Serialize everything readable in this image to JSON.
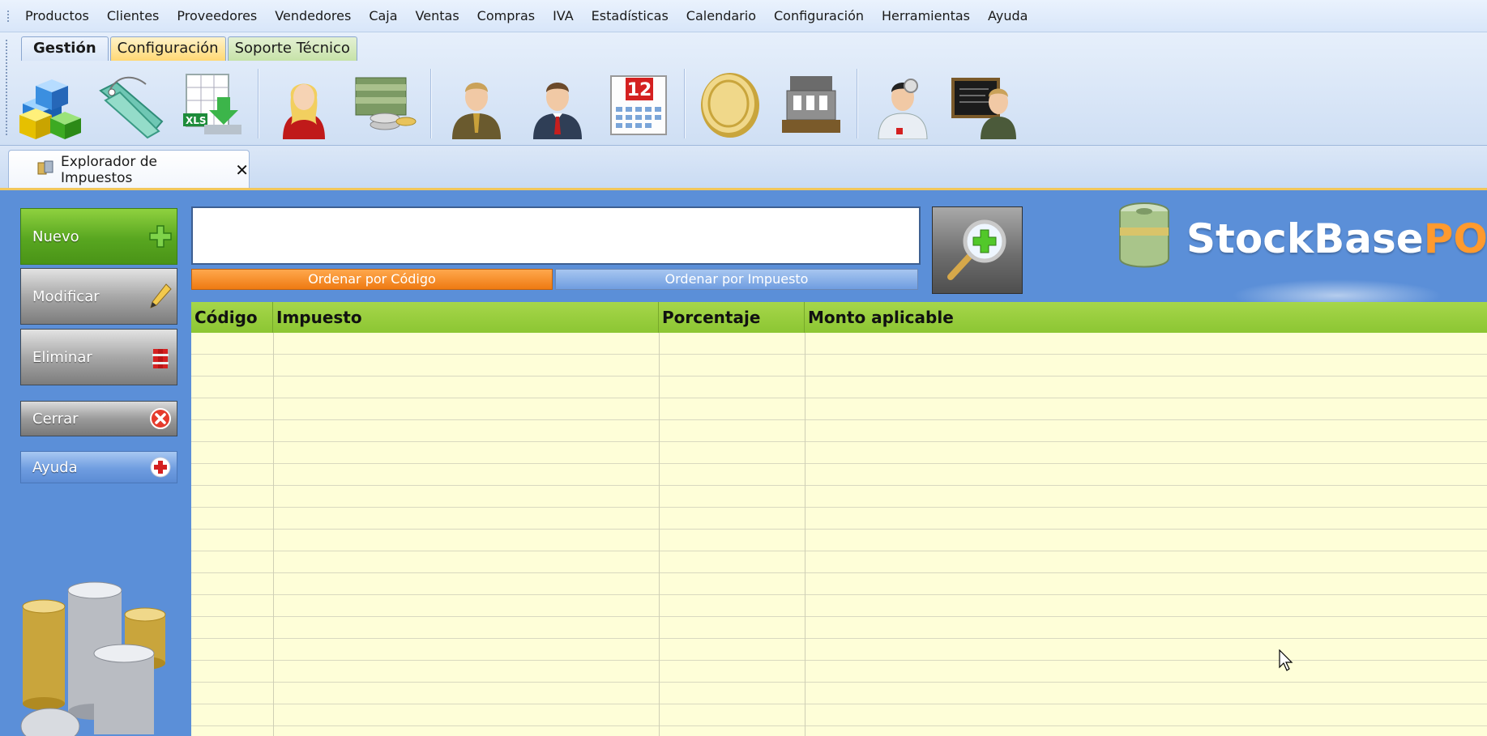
{
  "menu": [
    "Productos",
    "Clientes",
    "Proveedores",
    "Vendedores",
    "Caja",
    "Ventas",
    "Compras",
    "IVA",
    "Estadísticas",
    "Calendario",
    "Configuración",
    "Herramientas",
    "Ayuda"
  ],
  "ribbon": {
    "tabs": [
      "Gestión",
      "Configuración",
      "Soporte Técnico"
    ],
    "icons": [
      "products-cubes-icon",
      "price-tags-icon",
      "xls-import-icon",
      "customer-woman-icon",
      "cash-money-icon",
      "vendor-man-icon",
      "seller-man-icon",
      "calendar-icon",
      "coin-icon",
      "cash-register-icon",
      "doctor-support-icon",
      "teacher-board-icon"
    ],
    "calendar_day": "12",
    "xls_label": "XLS"
  },
  "document_tab": {
    "title": "Explorador de Impuestos",
    "close": "✕"
  },
  "sidebar": {
    "nuevo": "Nuevo",
    "modificar": "Modificar",
    "eliminar": "Eliminar",
    "cerrar": "Cerrar",
    "ayuda": "Ayuda"
  },
  "search": {
    "value": "",
    "placeholder": ""
  },
  "sort": {
    "by_code": "Ordenar por Código",
    "by_tax": "Ordenar por Impuesto",
    "active": "by_code"
  },
  "brand": {
    "name": "StockBase",
    "suffix": "POS"
  },
  "grid": {
    "columns": [
      "Código",
      "Impuesto",
      "Porcentaje",
      "Monto aplicable"
    ],
    "rows": []
  },
  "colors": {
    "accent_green": "#8cc633",
    "panel_blue": "#5b8fd8",
    "sort_orange": "#ee7a12",
    "grid_bg": "#fefed8"
  }
}
